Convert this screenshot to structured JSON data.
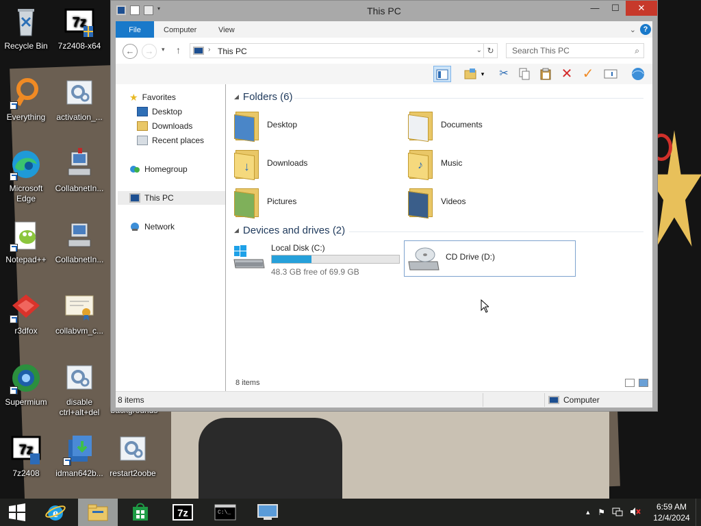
{
  "window": {
    "title": "This PC",
    "controls": {
      "minimize": "—",
      "maximize": "☐",
      "close": "✕"
    }
  },
  "ribbon": {
    "tabs": [
      {
        "label": "File"
      },
      {
        "label": "Computer"
      },
      {
        "label": "View"
      }
    ]
  },
  "address": {
    "path": "This PC",
    "search_placeholder": "Search This PC"
  },
  "nav_pane": {
    "items": [
      {
        "label": "Favorites"
      },
      {
        "label": "Desktop"
      },
      {
        "label": "Downloads"
      },
      {
        "label": "Recent places"
      },
      {
        "label": "Homegroup"
      },
      {
        "label": "This PC"
      },
      {
        "label": "Network"
      }
    ]
  },
  "content": {
    "folders_header": "Folders (6)",
    "folders": [
      {
        "label": "Desktop"
      },
      {
        "label": "Documents"
      },
      {
        "label": "Downloads"
      },
      {
        "label": "Music"
      },
      {
        "label": "Pictures"
      },
      {
        "label": "Videos"
      }
    ],
    "devices_header": "Devices and drives (2)",
    "drives": [
      {
        "label": "Local Disk (C:)",
        "free_text": "48.3 GB free of 69.9 GB",
        "used_fraction": 0.31
      },
      {
        "label": "CD Drive (D:)"
      }
    ],
    "items_count": "8 items"
  },
  "statusbar": {
    "items": "8 items",
    "location": "Computer"
  },
  "desktop_icons": [
    {
      "label": "Recycle Bin"
    },
    {
      "label": "7z2408-x64"
    },
    {
      "label": "Everything"
    },
    {
      "label": "activation_..."
    },
    {
      "label": "Microsoft Edge"
    },
    {
      "label": "CollabnetIn..."
    },
    {
      "label": "Notepad++"
    },
    {
      "label": "CollabnetIn..."
    },
    {
      "label": "r3dfox"
    },
    {
      "label": "collabvm_c..."
    },
    {
      "label": "Supermium"
    },
    {
      "label": "disable ctrl+alt+del"
    },
    {
      "label": "backgrounds"
    },
    {
      "label": "7z2408"
    },
    {
      "label": "idman642b..."
    },
    {
      "label": "restart2oobe"
    }
  ],
  "taskbar": {
    "time": "6:59 AM",
    "date": "12/4/2024",
    "apps": [
      "start",
      "internet-explorer",
      "file-explorer",
      "store",
      "7zip",
      "command-prompt",
      "remote-desktop"
    ]
  },
  "colors": {
    "accent": "#1979ca",
    "header_text": "#1e395b",
    "progress": "#26a0da",
    "close_button": "#c7392b"
  }
}
